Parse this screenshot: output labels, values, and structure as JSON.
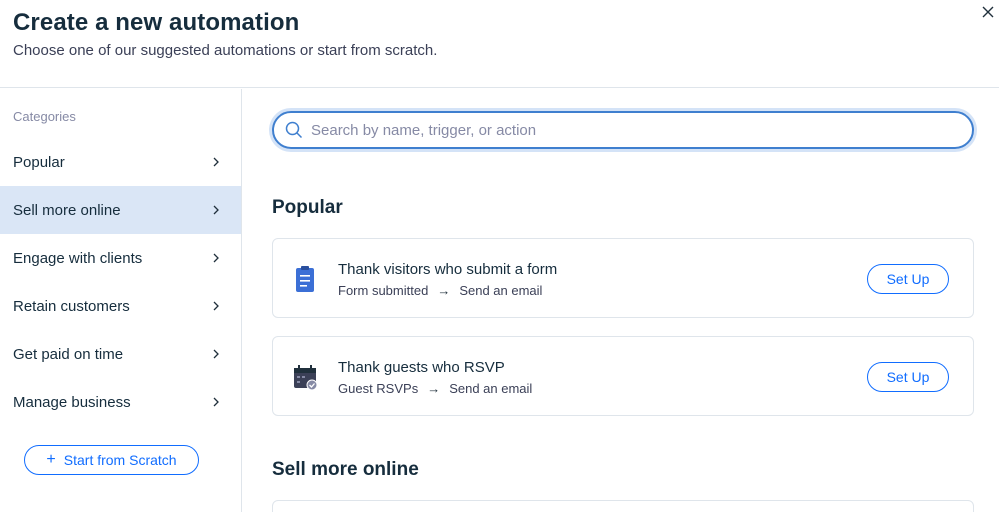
{
  "header": {
    "title": "Create a new automation",
    "subtitle": "Choose one of our suggested automations or start from scratch."
  },
  "sidebar": {
    "heading": "Categories",
    "items": [
      {
        "label": "Popular",
        "selected": false
      },
      {
        "label": "Sell more online",
        "selected": true
      },
      {
        "label": "Engage with clients",
        "selected": false
      },
      {
        "label": "Retain customers",
        "selected": false
      },
      {
        "label": "Get paid on time",
        "selected": false
      },
      {
        "label": "Manage business",
        "selected": false
      }
    ],
    "scratch_button": "Start from Scratch"
  },
  "search": {
    "placeholder": "Search by name, trigger, or action",
    "value": ""
  },
  "sections": [
    {
      "title": "Popular",
      "cards": [
        {
          "icon": "clipboard-form-icon",
          "title": "Thank visitors who submit a form",
          "trigger": "Form submitted",
          "action": "Send an email",
          "button": "Set Up"
        },
        {
          "icon": "calendar-check-icon",
          "title": "Thank guests who RSVP",
          "trigger": "Guest RSVPs",
          "action": "Send an email",
          "button": "Set Up"
        }
      ]
    },
    {
      "title": "Sell more online",
      "cards": []
    }
  ],
  "colors": {
    "accent": "#116dff",
    "selected_bg": "#dae6f6",
    "text": "#162d3d",
    "muted": "#868aa5",
    "border": "#dfe5eb"
  }
}
